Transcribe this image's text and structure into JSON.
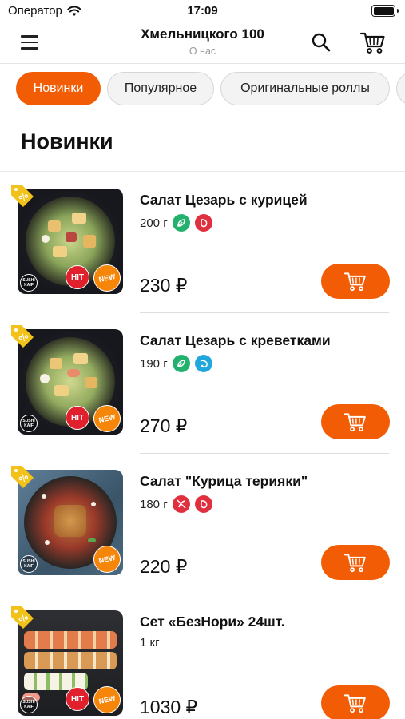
{
  "status": {
    "carrier": "Оператор",
    "time": "17:09"
  },
  "header": {
    "title": "Хмельницкого 100",
    "subtitle": "О нас"
  },
  "tabs": [
    {
      "label": "Новинки",
      "active": true
    },
    {
      "label": "Популярное",
      "active": false
    },
    {
      "label": "Оригинальные роллы",
      "active": false
    },
    {
      "label": "",
      "active": false
    }
  ],
  "section_title": "Новинки",
  "products": [
    {
      "name": "Салат Цезарь с курицей",
      "weight": "200 г",
      "price": "230 ₽",
      "diet_icons": [
        "leaf-icon",
        "meat-icon"
      ],
      "badges": [
        "HIT",
        "NEW"
      ]
    },
    {
      "name": "Салат Цезарь с креветками",
      "weight": "190 г",
      "price": "270 ₽",
      "diet_icons": [
        "leaf-icon",
        "shrimp-icon"
      ],
      "badges": [
        "HIT",
        "NEW"
      ]
    },
    {
      "name": "Салат \"Курица терияки\"",
      "weight": "180 г",
      "price": "220 ₽",
      "diet_icons": [
        "no-spicy-icon",
        "meat-icon"
      ],
      "badges": [
        "NEW"
      ]
    },
    {
      "name": "Сет «БезНори» 24шт.",
      "weight": "1 кг",
      "price": "1030 ₽",
      "diet_icons": [],
      "badges": [
        "HIT",
        "NEW"
      ]
    }
  ],
  "brand_logo_text": "SUSHI KAIF",
  "colors": {
    "accent": "#f25c05",
    "hit_badge": "#e0202c",
    "new_badge": "#f5860a",
    "discount_tag": "#f2c21a"
  }
}
